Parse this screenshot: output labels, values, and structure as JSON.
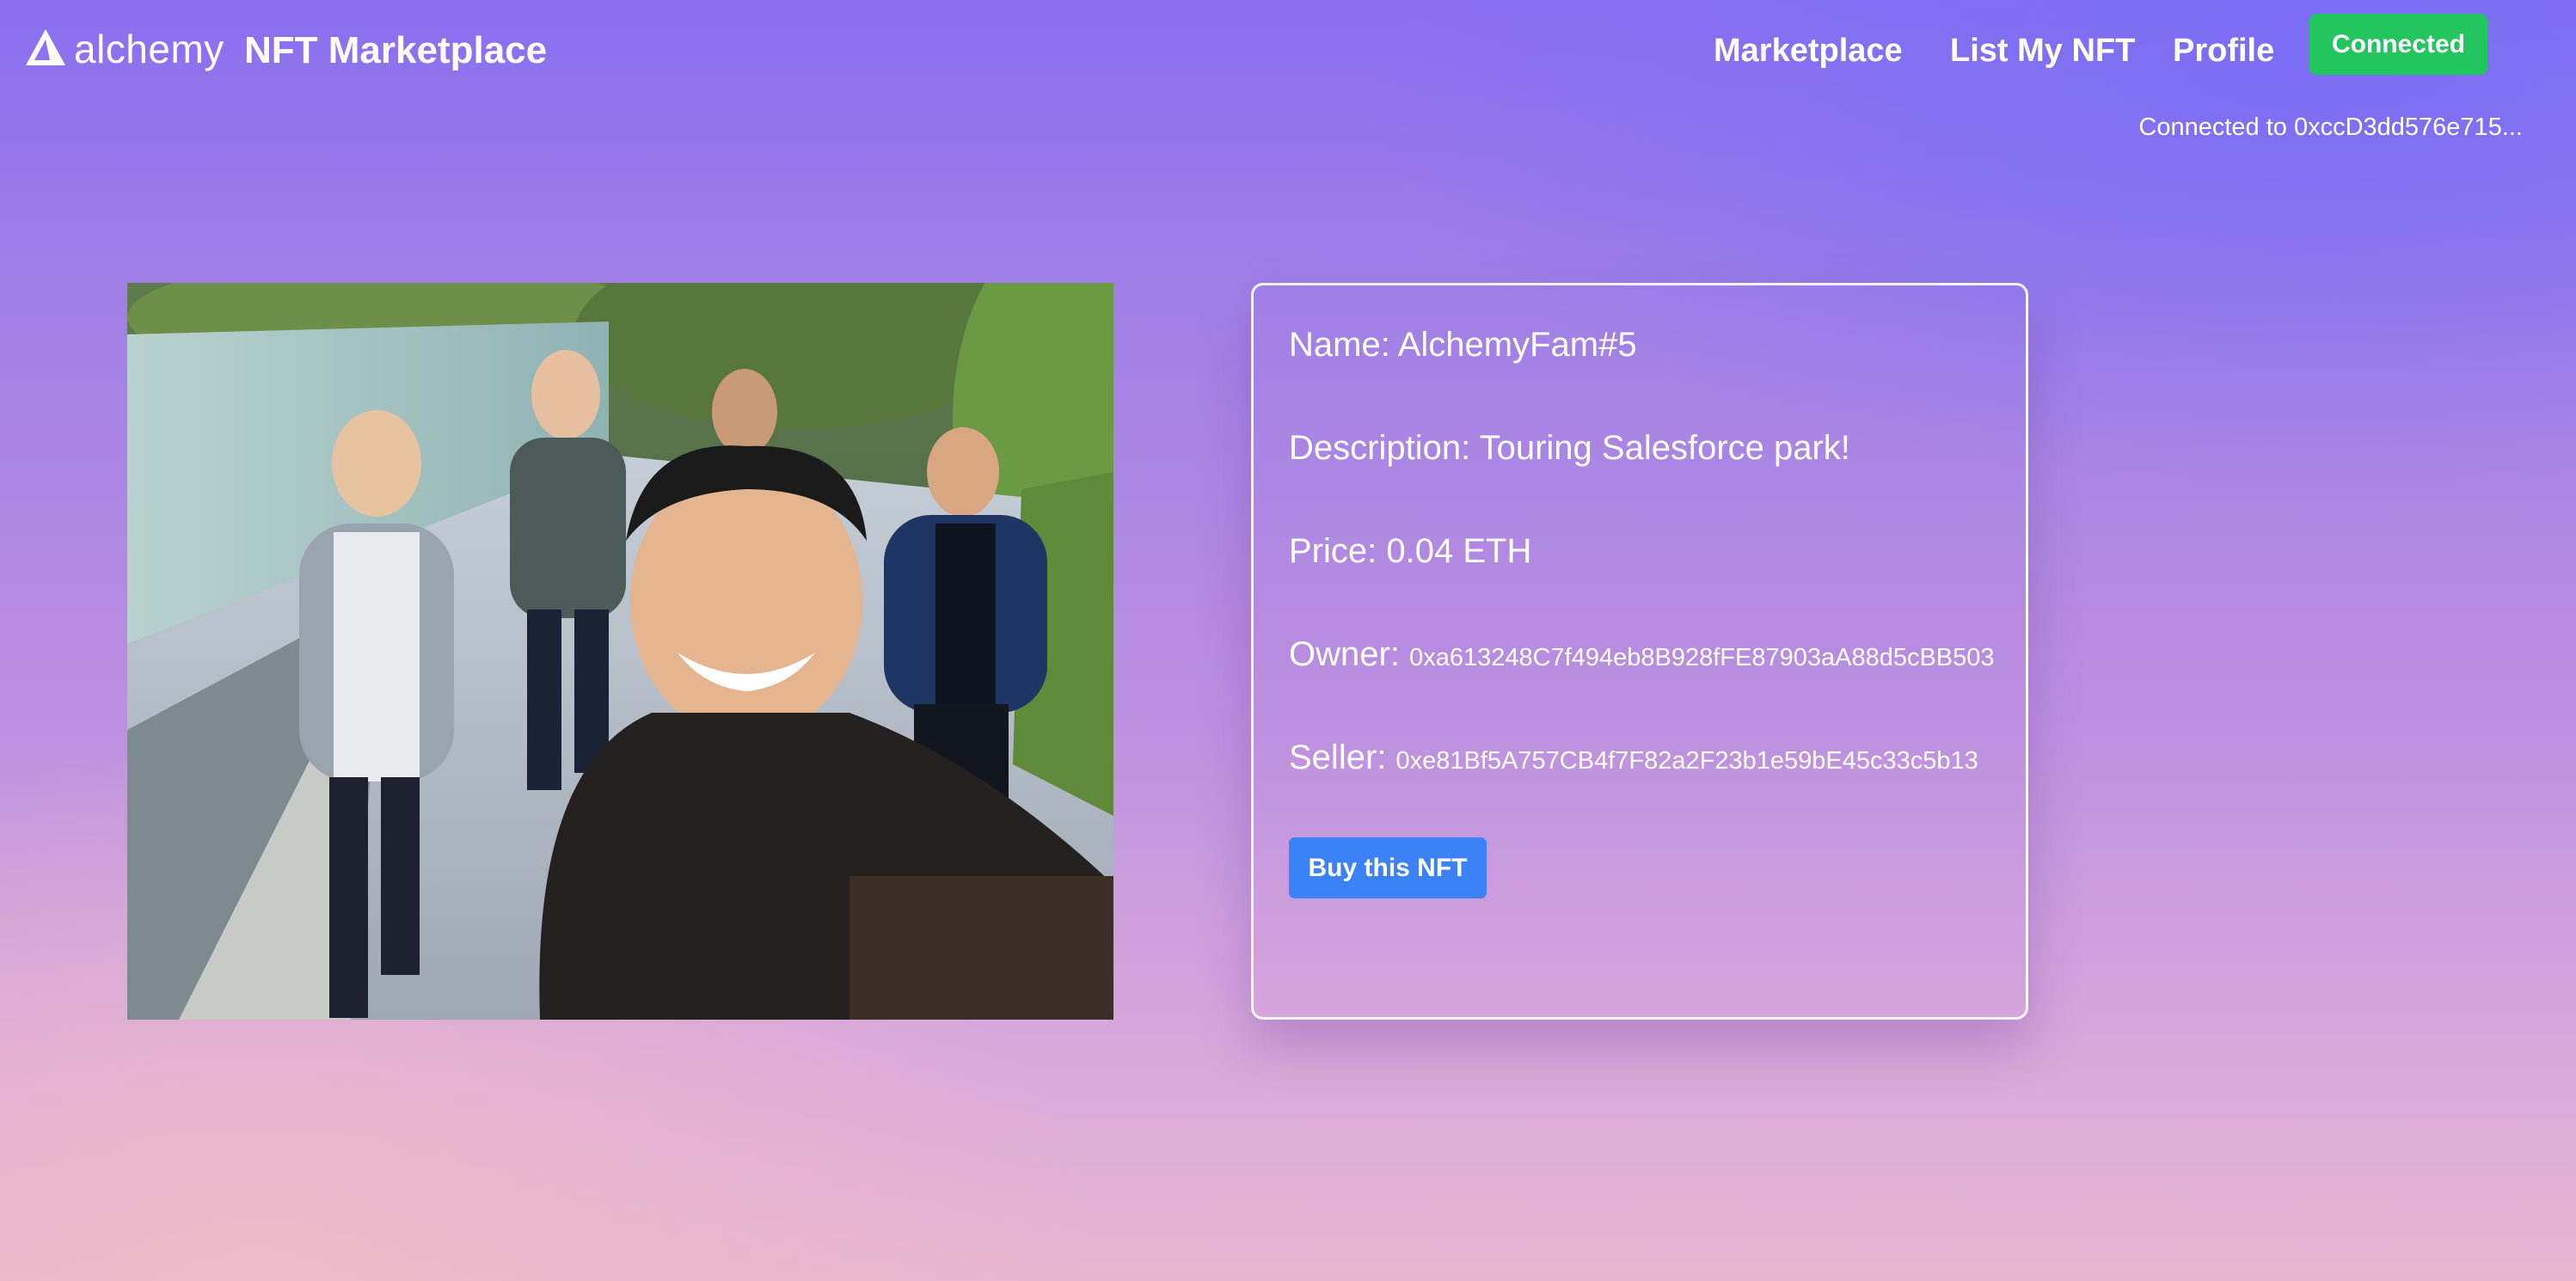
{
  "header": {
    "logo_text": "alchemy",
    "site_title": "NFT Marketplace",
    "nav": {
      "marketplace": "Marketplace",
      "list_nft": "List My NFT",
      "profile": "Profile"
    },
    "connect_button": "Connected",
    "connected_address": "Connected to 0xccD3dd576e715..."
  },
  "nft": {
    "name_label": "Name:",
    "name": "AlchemyFam#5",
    "description_label": "Description:",
    "description": "Touring Salesforce park!",
    "price_label": "Price:",
    "price": "0.04 ETH",
    "owner_label": "Owner:",
    "owner": "0xa613248C7f494eb8B928fFE87903aA88d5cBB503",
    "seller_label": "Seller:",
    "seller": "0xe81Bf5A757CB4f7F82a2F23b1e59bE45c33c5b13",
    "buy_button": "Buy this NFT"
  },
  "colors": {
    "connected_button": "#22c55e",
    "buy_button": "#3b82f6",
    "text": "#ffffff"
  }
}
